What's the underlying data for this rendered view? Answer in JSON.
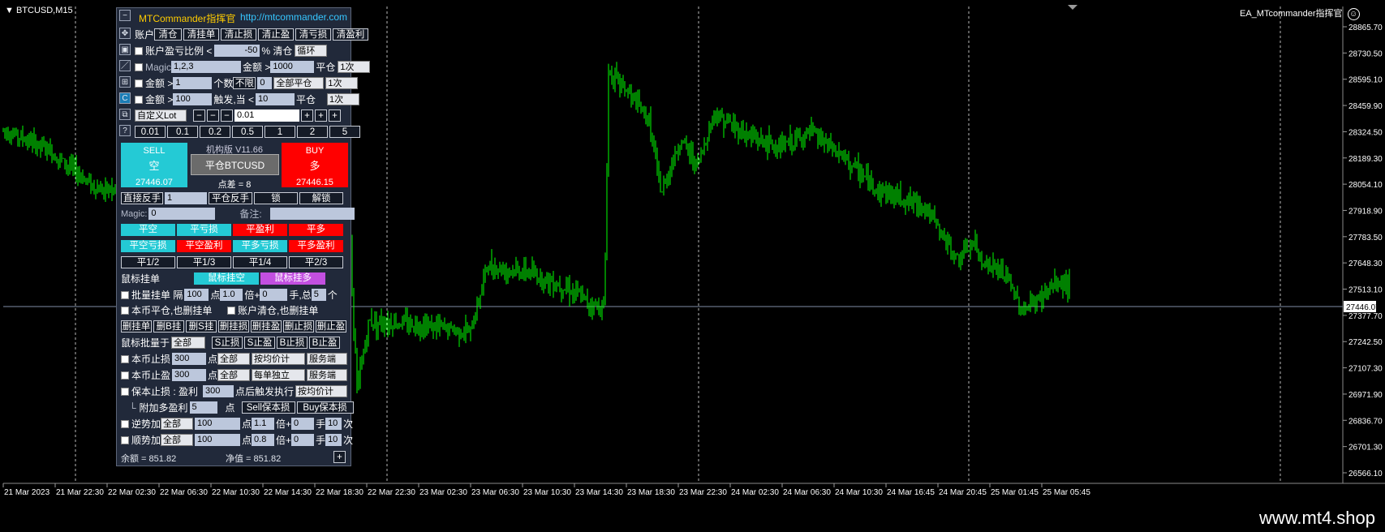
{
  "symbol_header": "BTCUSD,M15",
  "ea_label": "EA_MTcommander指挥官",
  "watermark": "www.mt4.shop",
  "current_price": "27446.07",
  "price_axis": [
    "28865.70",
    "28730.50",
    "28595.10",
    "28459.90",
    "28324.50",
    "28189.30",
    "28054.10",
    "27918.90",
    "27783.50",
    "27648.30",
    "27513.10",
    "27377.70",
    "27242.50",
    "27107.30",
    "26971.90",
    "26836.70",
    "26701.30",
    "26566.10"
  ],
  "time_axis": [
    "21 Mar 2023",
    "21 Mar 22:30",
    "22 Mar 02:30",
    "22 Mar 06:30",
    "22 Mar 10:30",
    "22 Mar 14:30",
    "22 Mar 18:30",
    "22 Mar 22:30",
    "23 Mar 02:30",
    "23 Mar 06:30",
    "23 Mar 10:30",
    "23 Mar 14:30",
    "23 Mar 18:30",
    "23 Mar 22:30",
    "24 Mar 02:30",
    "24 Mar 06:30",
    "24 Mar 10:30",
    "24 Mar 16:45",
    "24 Mar 20:45",
    "25 Mar 01:45",
    "25 Mar 05:45"
  ],
  "colors": {
    "candle": "#00ff00",
    "background": "#000000",
    "panel": "#21293a",
    "cyan": "#24cad5",
    "red": "#ff0000",
    "purple": "#c24fe0"
  },
  "panel": {
    "title": "MTCommander指挥官",
    "url": "http://mtcommander.com",
    "row1": {
      "label": "账户",
      "buttons": [
        "清仓",
        "清挂单",
        "清止损",
        "清止盈",
        "清亏损",
        "清盈利"
      ]
    },
    "row2": {
      "label": "账户盈亏比例 <",
      "value": "-50",
      "unit": "% 清仓",
      "mode": "循环"
    },
    "row3": {
      "label": "Magic",
      "value": "1,2,3",
      "amount_label": "金额 >",
      "amount": "1000",
      "action": "平仓",
      "times": "1次"
    },
    "row4": {
      "label": "金额 >",
      "value": "1",
      "count_label": "个数",
      "limit": "不限",
      "num": "0",
      "mode": "全部平仓",
      "times": "1次"
    },
    "row5": {
      "label": "金额 >",
      "value": "100",
      "trigger_label": "触发,当 <",
      "trigger": "10",
      "action": "平仓",
      "times": "1次"
    },
    "row6": {
      "lot_mode": "自定义Lot",
      "lot": "0.01"
    },
    "presets": [
      "0.01",
      "0.1",
      "0.2",
      "0.5",
      "1",
      "2",
      "5"
    ],
    "sell": {
      "label": "SELL",
      "cn": "空",
      "price": "27446.07"
    },
    "buy": {
      "label": "BUY",
      "cn": "多",
      "price": "27446.15"
    },
    "version": "机构版 V11.66",
    "close_symbol": "平仓BTCUSD",
    "spread_label": "点差 =",
    "spread": "8",
    "row_reverse": {
      "btn1": "直接反手",
      "value": "1",
      "btn2": "平仓反手",
      "btn3": "锁",
      "btn4": "解锁"
    },
    "row_magic": {
      "label": "Magic:",
      "value": "0",
      "note_label": "备注:"
    },
    "close_row1": [
      "平空",
      "平亏损",
      "平盈利",
      "平多"
    ],
    "close_row2": [
      "平空亏损",
      "平空盈利",
      "平多亏损",
      "平多盈利"
    ],
    "close_row3": [
      "平1/2",
      "平1/3",
      "平1/4",
      "平2/3"
    ],
    "mouse_pending": {
      "label": "鼠标挂单",
      "sell": "鼠标挂空",
      "buy": "鼠标挂多"
    },
    "batch": {
      "l1": "批量挂单 隔",
      "v1": "100",
      "l2": "点",
      "v2": "1.0",
      "l3": "倍+",
      "v3": "0",
      "l4": "手,总",
      "v4": "5",
      "l5": "个"
    },
    "opts": {
      "a": "本币平仓,也删挂单",
      "b": "账户清仓,也删挂单"
    },
    "del_buttons": [
      "删挂单",
      "删B挂",
      "删S挂",
      "删挂损",
      "删挂盈",
      "删止损",
      "删止盈"
    ],
    "mouse_batch": {
      "label": "鼠标批量于",
      "sel": "全部",
      "btns": [
        "S止损",
        "S止盈",
        "B止损",
        "B止盈"
      ]
    },
    "sl": {
      "label": "本币止损",
      "value": "300",
      "unit": "点",
      "scope": "全部",
      "calc": "按均价计",
      "side": "服务端"
    },
    "tp": {
      "label": "本币止盈",
      "value": "300",
      "unit": "点",
      "scope": "全部",
      "calc": "每单独立",
      "side": "服务端"
    },
    "be": {
      "label": "保本止损 : 盈利",
      "value": "300",
      "unit": "点后触发执行",
      "calc": "按均价计"
    },
    "extra": {
      "label": "附加多盈利",
      "value": "5",
      "unit": "点",
      "btn1": "Sell保本损",
      "btn2": "Buy保本损"
    },
    "rev": {
      "label": "逆势加",
      "scope": "全部",
      "value": "100",
      "l1": "点",
      "mult": "1.1",
      "l2": "倍+",
      "add": "0",
      "l3": "手",
      "times": "10",
      "l4": "次"
    },
    "trend": {
      "label": "顺势加",
      "scope": "全部",
      "value": "100",
      "l1": "点",
      "mult": "0.8",
      "l2": "倍+",
      "add": "0",
      "l3": "手",
      "times": "10",
      "l4": "次"
    },
    "balance_label": "余额 = 851.82",
    "equity_label": "净值 = 851.82"
  }
}
